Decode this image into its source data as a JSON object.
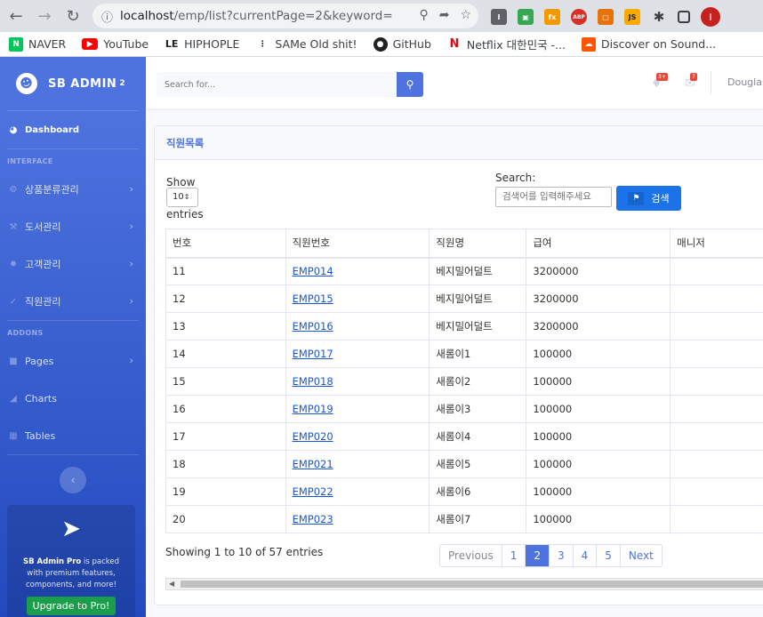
{
  "browser": {
    "url_host": "localhost",
    "url_path": "/emp/list?currentPage=2&keyword=",
    "bookmarks": [
      "NAVER",
      "YouTube",
      "HIPHOPLE",
      "SAMe Old shit!",
      "GitHub",
      "Netflix 대한민국 -...",
      "Discover on Sound..."
    ],
    "profile_initial": "I"
  },
  "sidebar": {
    "brand": "SB ADMIN",
    "brand_sup": "2",
    "dashboard": "Dashboard",
    "heading_interface": "INTERFACE",
    "heading_addons": "ADDONS",
    "items": [
      "상품분류관리",
      "도서관리",
      "고객관리",
      "직원관리"
    ],
    "addons": [
      "Pages",
      "Charts",
      "Tables"
    ],
    "promo_title": "SB Admin Pro",
    "promo_text": " is packed with premium features, components, and more!",
    "upgrade": "Upgrade to Pro!"
  },
  "topbar": {
    "search_placeholder": "Search for...",
    "alerts_count": "3+",
    "messages_count": "7",
    "user_name": "Douglas"
  },
  "card": {
    "title": "직원목록",
    "show_label": "Show",
    "length_value": "10",
    "entries_label": "entries",
    "search_label": "Search:",
    "search_placeholder": "검색어를 입력해주세요",
    "search_button": "검색"
  },
  "table": {
    "headers": [
      "번호",
      "직원번호",
      "직원명",
      "급여",
      "매니저"
    ],
    "rows": [
      [
        "11",
        "EMP014",
        "베지밀어덜트",
        "3200000",
        ""
      ],
      [
        "12",
        "EMP015",
        "베지밀어덜트",
        "3200000",
        ""
      ],
      [
        "13",
        "EMP016",
        "베지밀어덜트",
        "3200000",
        ""
      ],
      [
        "14",
        "EMP017",
        "새롬이1",
        "100000",
        ""
      ],
      [
        "15",
        "EMP018",
        "새롬이2",
        "100000",
        ""
      ],
      [
        "16",
        "EMP019",
        "새롬이3",
        "100000",
        ""
      ],
      [
        "17",
        "EMP020",
        "새롬이4",
        "100000",
        ""
      ],
      [
        "18",
        "EMP021",
        "새롬이5",
        "100000",
        ""
      ],
      [
        "19",
        "EMP022",
        "새롬이6",
        "100000",
        ""
      ],
      [
        "20",
        "EMP023",
        "새롬이7",
        "100000",
        ""
      ]
    ]
  },
  "pagination": {
    "info": "Showing 1 to 10 of 57 entries",
    "previous": "Previous",
    "pages": [
      "1",
      "2",
      "3",
      "4",
      "5"
    ],
    "active_page": "2",
    "next": "Next"
  }
}
